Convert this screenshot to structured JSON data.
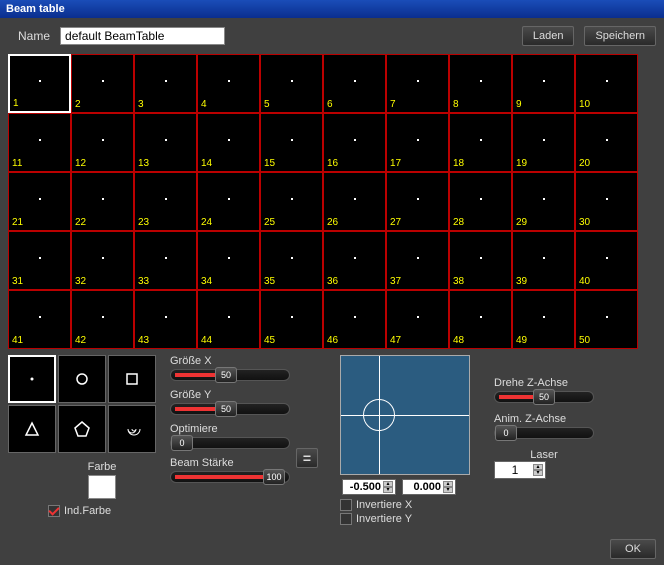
{
  "window": {
    "title": "Beam table"
  },
  "header": {
    "name_label": "Name",
    "name_value": "default BeamTable",
    "load_label": "Laden",
    "save_label": "Speichern"
  },
  "grid": {
    "rows": 5,
    "cols": 10,
    "selected": 1
  },
  "shapes": {
    "selected": 0,
    "names": [
      "dot-shape",
      "circle-shape",
      "square-shape",
      "triangle-shape",
      "pentagon-shape",
      "spiral-shape"
    ]
  },
  "color": {
    "label": "Farbe",
    "ind_label": "Ind.Farbe",
    "ind_checked": true,
    "swatch": "#ffffff"
  },
  "sliders": {
    "size_x": {
      "label": "Größe X",
      "value": 50,
      "max": 100
    },
    "size_y": {
      "label": "Größe Y",
      "value": 50,
      "max": 100
    },
    "optimize": {
      "label": "Optimiere",
      "value": 0,
      "max": 100
    },
    "beam_strength": {
      "label": "Beam Stärke",
      "value": 100,
      "max": 100
    }
  },
  "equal_button": "=",
  "preview": {
    "x_value": "-0.500",
    "y_value": "0.000",
    "invert_x_label": "Invertiere X",
    "invert_y_label": "Invertiere Y",
    "invert_x": false,
    "invert_y": false
  },
  "right": {
    "rotate_z": {
      "label": "Drehe Z-Achse",
      "value": 50,
      "max": 100
    },
    "anim_z": {
      "label": "Anim. Z-Achse",
      "value": 0,
      "max": 100
    },
    "laser_label": "Laser",
    "laser_value": "1"
  },
  "ok_label": "OK"
}
